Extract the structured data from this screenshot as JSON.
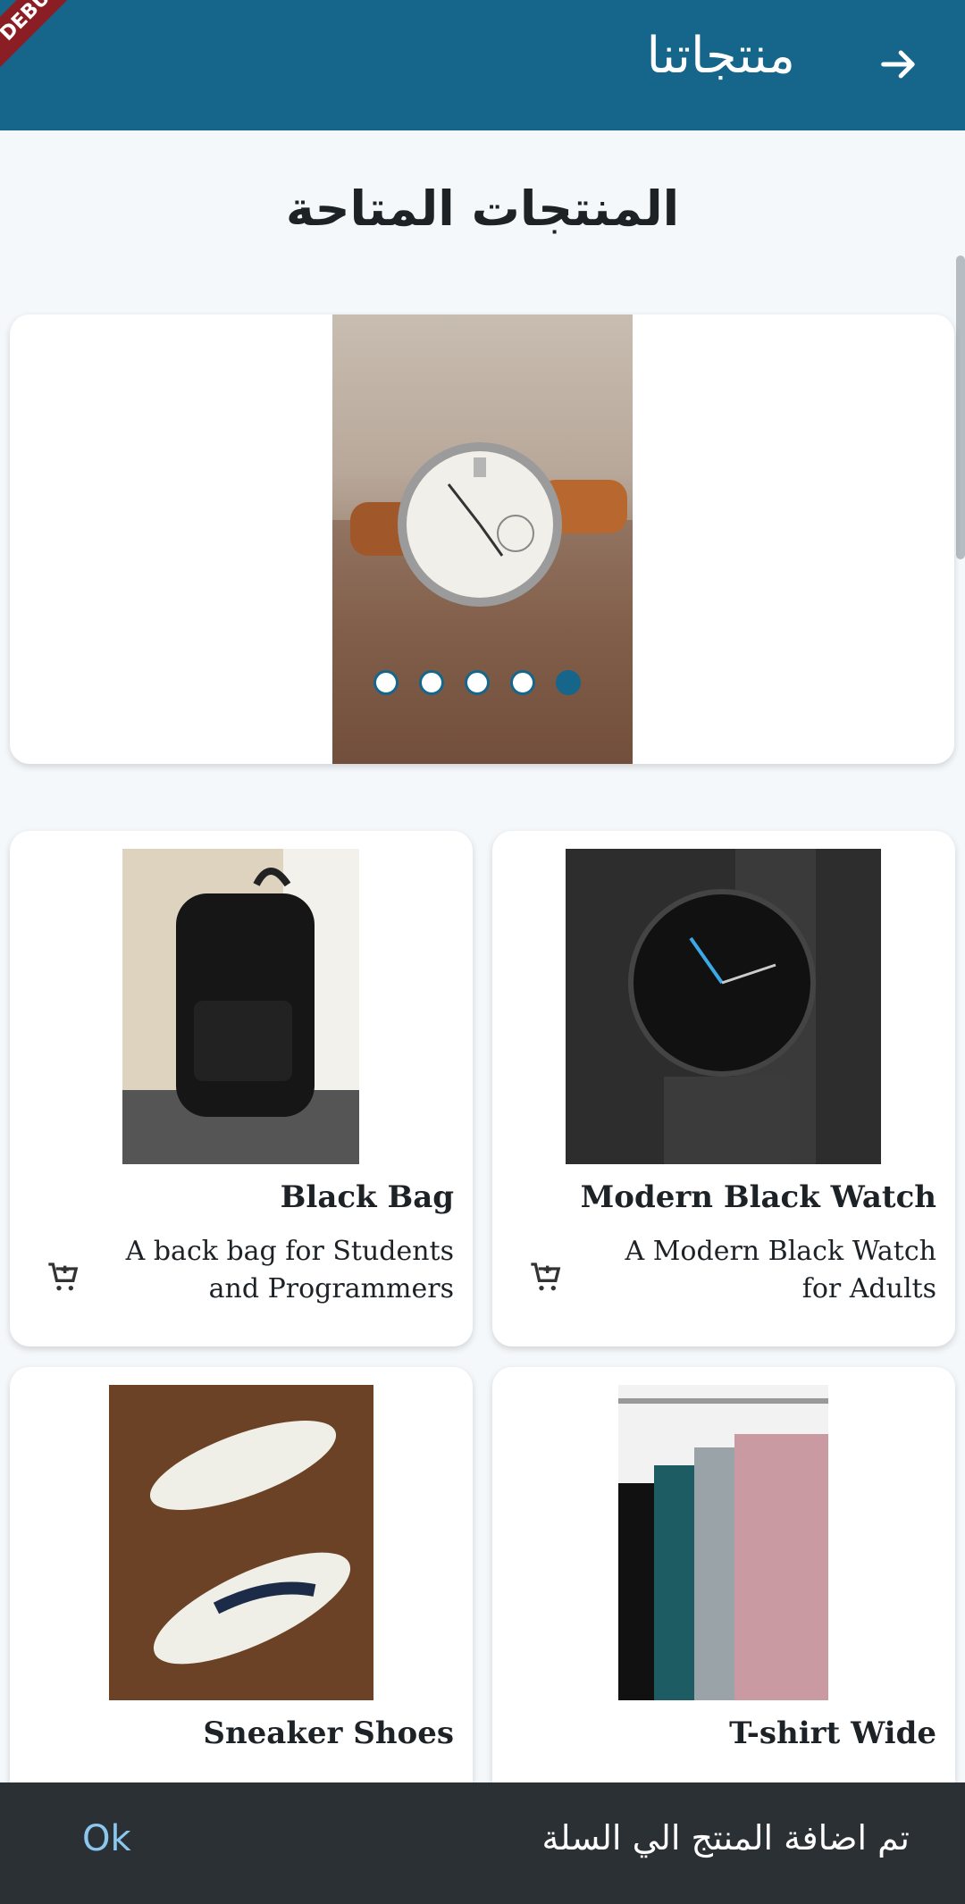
{
  "appbar": {
    "title": "منتجاتنا",
    "ribbon": "DEBUG"
  },
  "section_title": "المنتجات المتاحة",
  "carousel": {
    "total": 5,
    "active_index": 4
  },
  "products": [
    {
      "name": "Black Bag",
      "description": "A back bag for Students and Programmers"
    },
    {
      "name": "Modern Black Watch",
      "description": "A Modern Black Watch for Adults"
    },
    {
      "name": "Sneaker Shoes",
      "description": ""
    },
    {
      "name": "T-shirt Wide",
      "description": ""
    }
  ],
  "snackbar": {
    "message": "تم اضافة المنتج الي السلة",
    "action": "Ok"
  },
  "colors": {
    "primary": "#15668a",
    "snackbar_bg": "#2b3035",
    "snackbar_action": "#8bc7ee"
  }
}
